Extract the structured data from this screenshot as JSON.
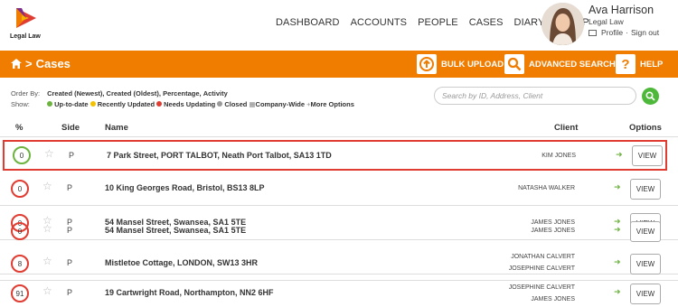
{
  "brand": {
    "name": "Legal Law"
  },
  "nav": [
    {
      "label": "DASHBOARD"
    },
    {
      "label": "ACCOUNTS"
    },
    {
      "label": "PEOPLE"
    },
    {
      "label": "CASES"
    },
    {
      "label": "DIARY"
    },
    {
      "label": "SETUP"
    }
  ],
  "user": {
    "name": "Ava Harrison",
    "org": "Legal Law",
    "profile": "Profile",
    "sep": "·",
    "signout": "Sign out"
  },
  "breadcrumb": {
    "gt": ">",
    "title": "Cases"
  },
  "actions": {
    "bulk_upload": "BULK UPLOAD",
    "advanced_search": "ADVANCED SEARCH",
    "help": "HELP"
  },
  "filters": {
    "order_label": "Order By:",
    "order_options": [
      "Created (Newest),",
      "Created (Oldest),",
      "Percentage,",
      "Activity"
    ],
    "show_label": "Show:",
    "show_options": [
      {
        "label": "Up-to-date",
        "color": "#6db33f"
      },
      {
        "label": "Recently Updated",
        "color": "#f2c200"
      },
      {
        "label": "Needs Updating",
        "color": "#e03c31"
      },
      {
        "label": "Closed",
        "color": "#9a9a9a"
      }
    ],
    "company_wide": "Company-Wide",
    "more_options": "More Options"
  },
  "search": {
    "placeholder": "Search by ID, Address, Client"
  },
  "table": {
    "headers": {
      "pct": "%",
      "side": "Side",
      "name": "Name",
      "client": "Client",
      "options": "Options"
    },
    "rows": [
      {
        "pct": "0",
        "side": "P",
        "name": "7 Park Street, PORT TALBOT, Neath Port Talbot, SA13 1TD",
        "client1": "KIM JONES",
        "client2": "",
        "view": "VIEW"
      },
      {
        "pct": "0",
        "side": "P",
        "name": "10 King Georges Road, Bristol, BS13 8LP",
        "client1": "NATASHA WALKER",
        "client2": "",
        "view": "VIEW"
      },
      {
        "pct": "0",
        "side": "P",
        "name": "54 Mansel Street, Swansea, SA1 5TE",
        "client1": "JAMES JONES",
        "client2": "",
        "view": "VIEW"
      },
      {
        "pct": "0",
        "side": "P",
        "name": "54 Mansel Street, Swansea, SA1 5TE",
        "client1": "JAMES JONES",
        "client2": "",
        "view": "VIEW"
      },
      {
        "pct": "8",
        "side": "P",
        "name": "Mistletoe Cottage, LONDON, SW13 3HR",
        "client1": "JONATHAN CALVERT",
        "client2": "JOSEPHINE CALVERT",
        "view": "VIEW"
      },
      {
        "pct": "91",
        "side": "P",
        "name": "19 Cartwright Road, Northampton, NN2 6HF",
        "client1": "JOSEPHINE CALVERT",
        "client2": "JAMES JONES",
        "view": "VIEW"
      }
    ]
  },
  "colors": {
    "accent": "#f07c00",
    "highlight": "#e03c31",
    "green": "#6db33f"
  }
}
